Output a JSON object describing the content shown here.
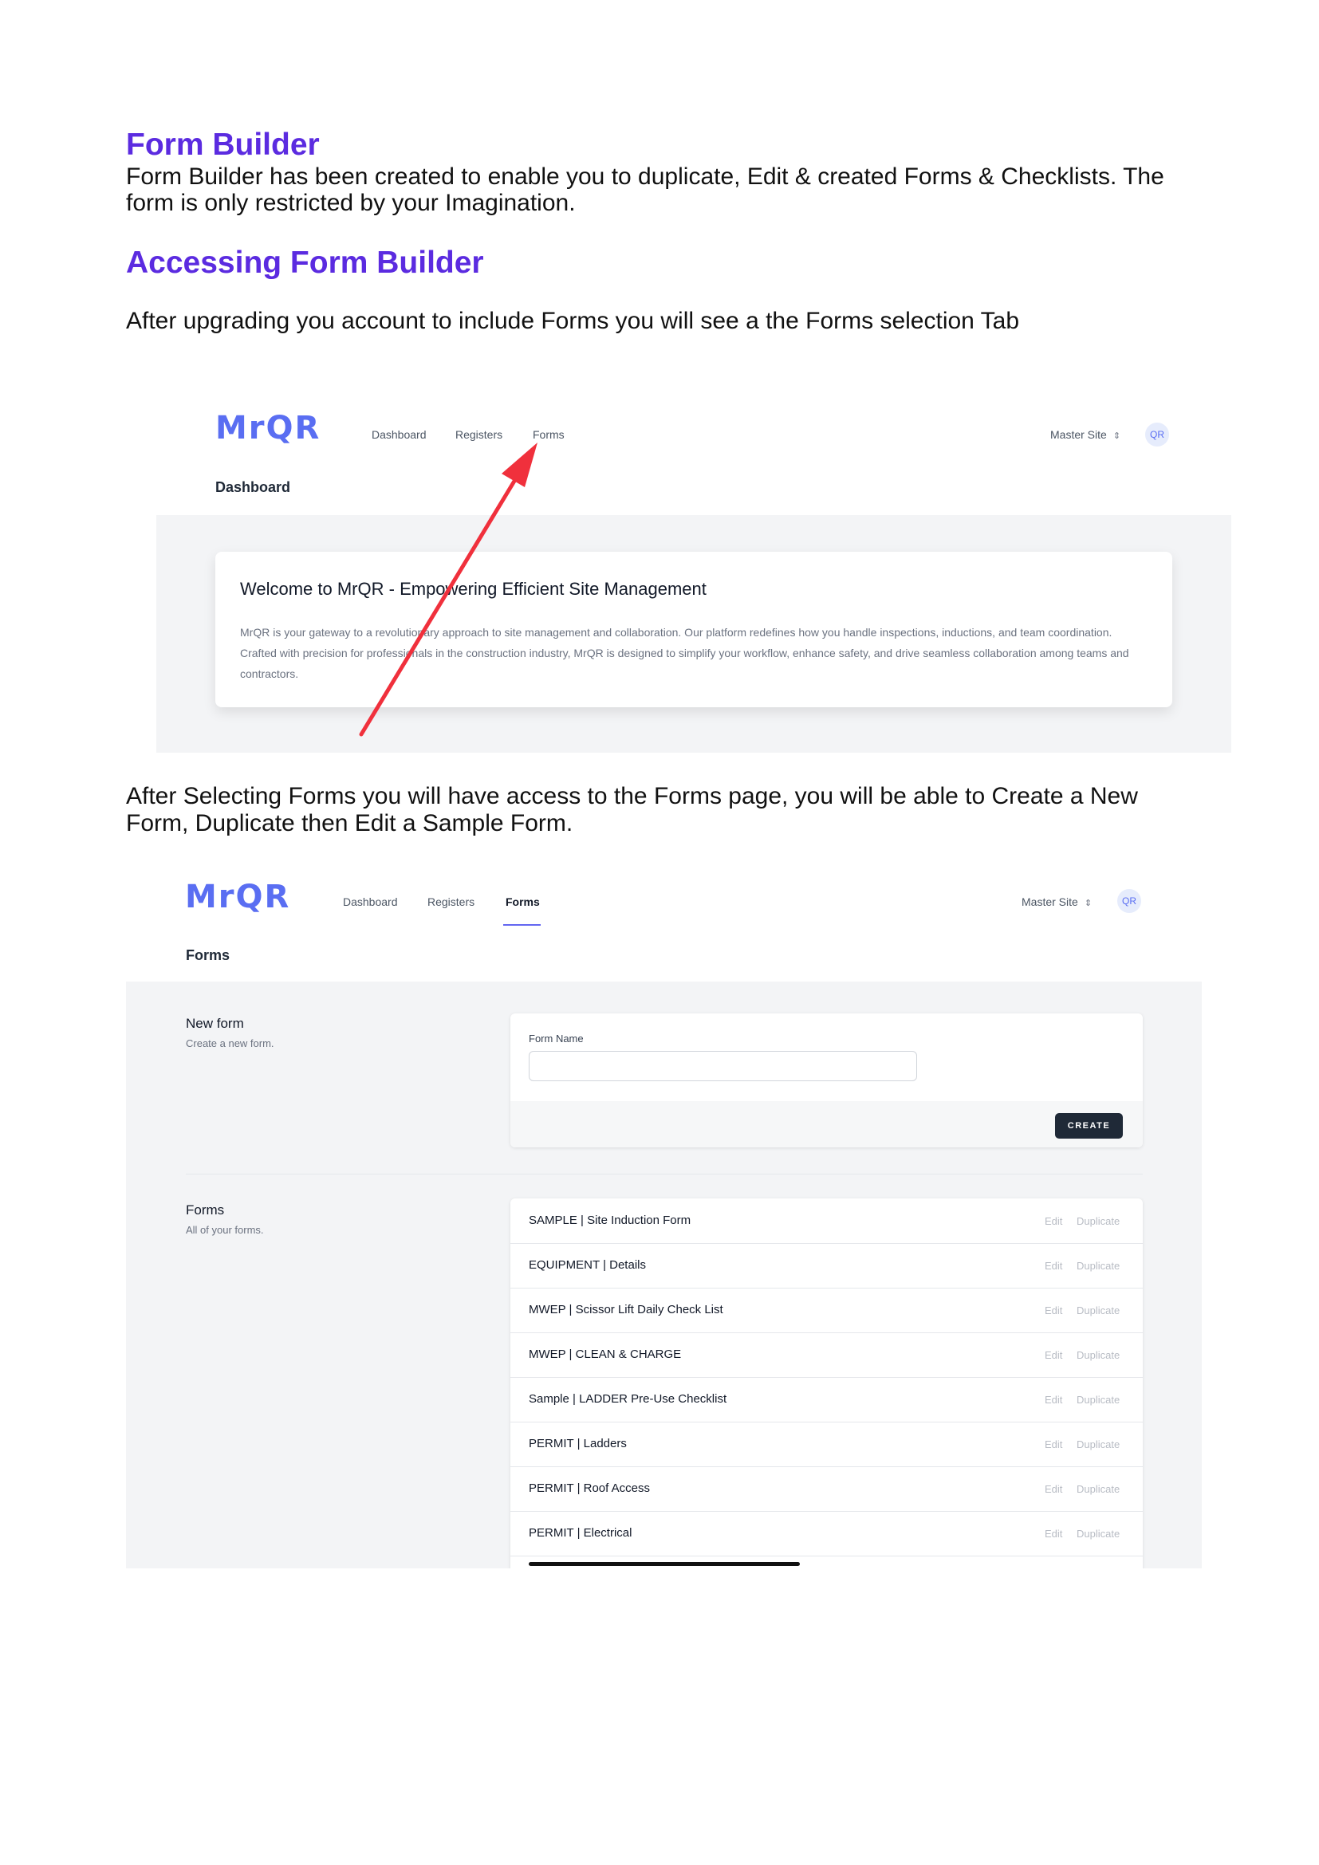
{
  "doc": {
    "heading1": "Form Builder",
    "intro_line1": "Form Builder has been created to enable you to duplicate, Edit & created Forms & Checklists. The",
    "intro_line2": "form is only restricted by your Imagination.",
    "heading2": "Accessing Form Builder",
    "para2": "After upgrading you account to include Forms you will see a the Forms selection Tab",
    "para3_line1": "After Selecting Forms you will have access to the Forms page, you will be able to Create a New",
    "para3_line2": "Form, Duplicate then Edit a Sample Form."
  },
  "app": {
    "logo": "MrQR",
    "nav": {
      "dashboard": "Dashboard",
      "registers": "Registers",
      "forms": "Forms"
    },
    "site_selector": "Master Site",
    "avatar": "QR",
    "colors": {
      "brand": "#5a6ef2",
      "heading": "#5b2be0",
      "arrow": "#f0303c",
      "button": "#1f2937"
    }
  },
  "shot1": {
    "page_title": "Dashboard",
    "welcome_title": "Welcome to MrQR - Empowering Efficient Site Management",
    "welcome_body": "MrQR is your gateway to a revolutionary approach to site management and collaboration. Our platform redefines how you handle inspections, inductions, and team coordination. Crafted with precision for professionals in the construction industry, MrQR is designed to simplify your workflow, enhance safety, and drive seamless collaboration among teams and contractors."
  },
  "shot2": {
    "page_title": "Forms",
    "new_form": {
      "title": "New form",
      "desc": "Create a new form.",
      "field_label": "Form Name",
      "field_value": "",
      "button": "CREATE"
    },
    "forms_section": {
      "title": "Forms",
      "desc": "All of your forms."
    },
    "row_actions": {
      "edit": "Edit",
      "duplicate": "Duplicate"
    },
    "forms": [
      "SAMPLE | Site Induction Form",
      "EQUIPMENT | Details",
      "MWEP | Scissor Lift Daily Check List",
      "MWEP | CLEAN & CHARGE",
      "Sample | LADDER Pre-Use Checklist",
      "PERMIT | Ladders",
      "PERMIT | Roof Access",
      "PERMIT | Electrical"
    ]
  }
}
